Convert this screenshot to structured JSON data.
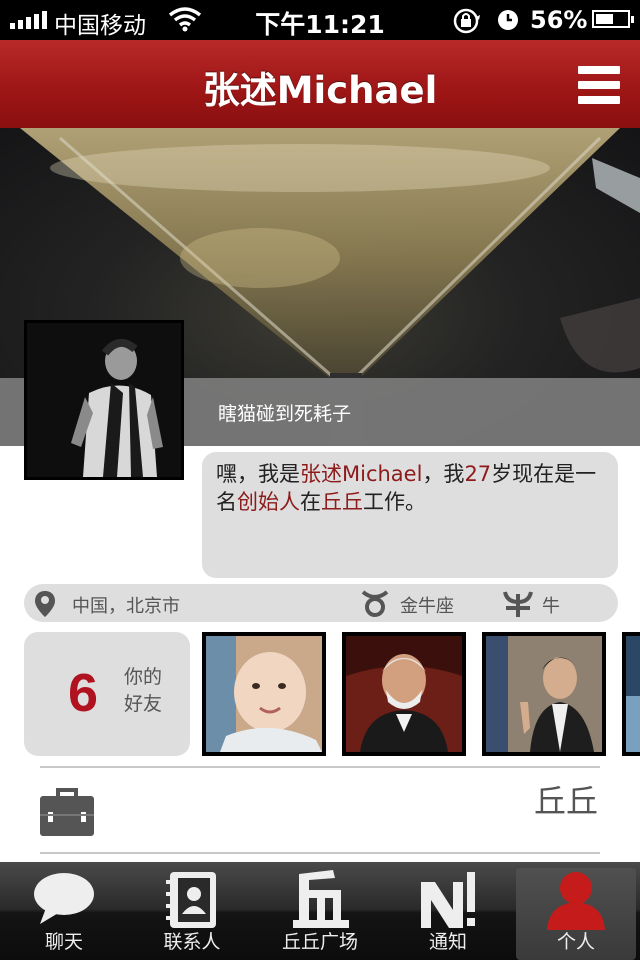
{
  "status_bar": {
    "carrier": "中国移动",
    "time": "下午11:21",
    "battery": "56%",
    "battery_level": 0.56
  },
  "nav": {
    "title": "张述Michael",
    "menu_icon": "hamburger-menu-icon"
  },
  "profile": {
    "tagline": "瞎猫碰到死耗子",
    "bio": {
      "p1": "嘿，我是",
      "name": "张述Michael",
      "p2": "，我",
      "age": "27",
      "p3": "岁现在是一名",
      "role": "创始人",
      "p4": "在",
      "company": "丘丘",
      "p5": "工作。"
    },
    "location": "中国，北京市",
    "zodiac": "金牛座",
    "chinese_zodiac": "牛"
  },
  "friends": {
    "count": "6",
    "label": "你的好友"
  },
  "work": {
    "company": "丘丘"
  },
  "tabs": [
    {
      "label": "聊天",
      "icon": "chat-bubble-icon"
    },
    {
      "label": "联系人",
      "icon": "contacts-book-icon"
    },
    {
      "label": "丘丘广场",
      "icon": "qiuqiu-square-icon"
    },
    {
      "label": "通知",
      "icon": "notification-icon"
    },
    {
      "label": "个人",
      "icon": "person-icon",
      "active": true
    }
  ],
  "colors": {
    "brand_red": "#9f1616",
    "highlight": "#8d1b1b",
    "count_red": "#b0131f",
    "panel_gray": "#dedede"
  }
}
